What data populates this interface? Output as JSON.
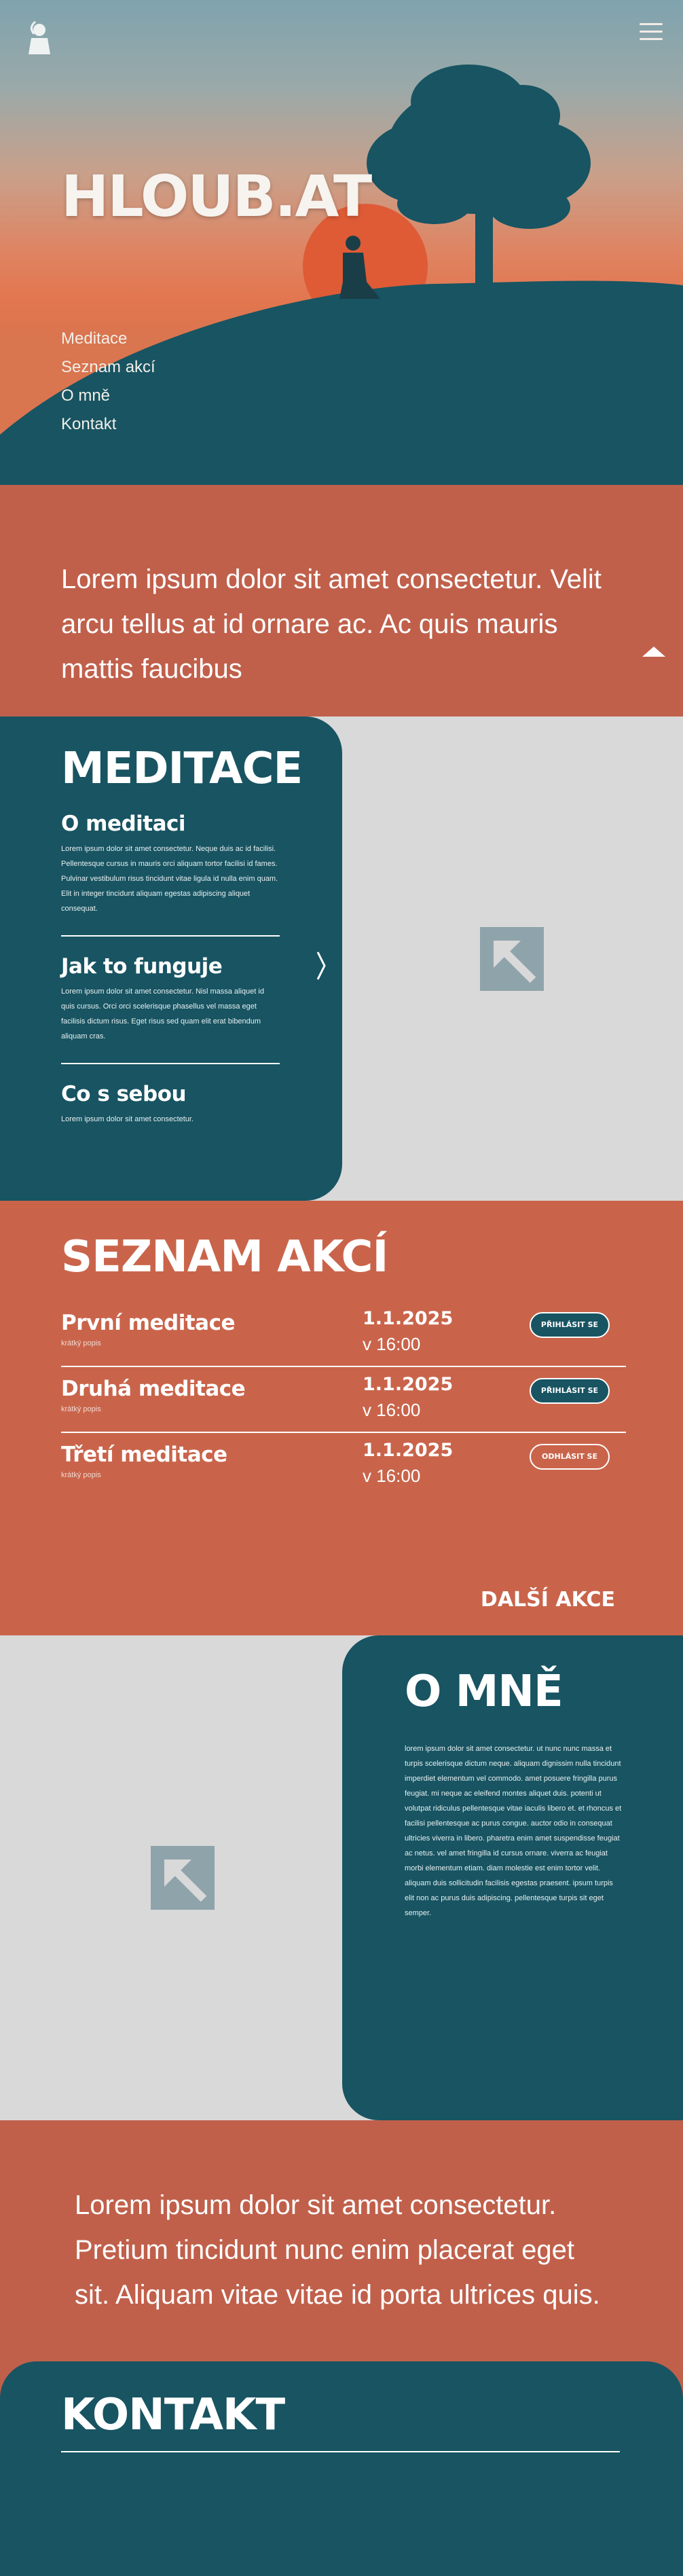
{
  "hero": {
    "brand": "HLOUB.AT",
    "nav": [
      "Meditace",
      "Seznam akcí",
      "O mně",
      "Kontakt"
    ]
  },
  "quote1": "Lorem ipsum dolor sit amet consectetur. Velit arcu tellus at id ornare ac. Ac quis mauris mattis faucibus",
  "meditace": {
    "title": "MEDITACE",
    "items": [
      {
        "title": "O meditaci",
        "text": "Lorem ipsum dolor sit amet consectetur. Neque duis ac id facilisi. Pellentesque cursus in mauris orci aliquam tortor facilisi id fames. Pulvinar vestibulum risus tincidunt vitae ligula id nulla enim quam. Elit in integer tincidunt aliquam egestas adipiscing aliquet consequat."
      },
      {
        "title": "Jak to funguje",
        "text": "Lorem ipsum dolor sit amet consectetur. Nisl massa aliquet id quis cursus. Orci orci scelerisque phasellus vel massa eget facilisis dictum risus. Eget risus sed quam elit erat bibendum aliquam cras."
      },
      {
        "title": "Co s sebou",
        "text": "Lorem ipsum dolor sit amet consectetur."
      }
    ]
  },
  "akce": {
    "title": "SEZNAM AKCÍ",
    "rows": [
      {
        "name": "První meditace",
        "sub": "krátký popis",
        "date": "1.1.2025",
        "time": "v 16:00",
        "button": "PŘIHLÁSIT SE",
        "state": "on"
      },
      {
        "name": "Druhá meditace",
        "sub": "krátký popis",
        "date": "1.1.2025",
        "time": "v 16:00",
        "button": "PŘIHLÁSIT SE",
        "state": "on"
      },
      {
        "name": "Třetí meditace",
        "sub": "krátký popis",
        "date": "1.1.2025",
        "time": "v 16:00",
        "button": "ODHLÁSIT SE",
        "state": "off"
      }
    ],
    "more": "DALŠÍ AKCE"
  },
  "omne": {
    "title": "O MNĚ",
    "text": "lorem ipsum dolor sit amet consectetur. ut nunc nunc massa et turpis scelerisque dictum neque. aliquam dignissim nulla tincidunt imperdiet elementum vel commodo. amet posuere fringilla purus feugiat. mi neque ac eleifend montes aliquet duis. potenti ut volutpat ridiculus pellentesque vitae iaculis libero et. et rhoncus et facilisi pellentesque ac purus congue. auctor odio in consequat ultricies viverra in libero. pharetra enim amet suspendisse feugiat ac netus. vel amet fringilla id cursus ornare. viverra ac feugiat morbi elementum etiam. diam molestie est enim tortor velit. aliquam duis sollicitudin facilisis egestas praesent. ipsum turpis elit non ac purus duis adipiscing. pellentesque turpis sit eget semper."
  },
  "quote2": "Lorem ipsum dolor sit amet consectetur. Pretium tincidunt nunc enim placerat eget sit. Aliquam vitae vitae id porta ultrices quis.",
  "kontakt": {
    "title": "KONTAKT"
  },
  "colors": {
    "teal": "#185462",
    "terracotta": "#c0604b",
    "placeholder": "#d9d9d9"
  }
}
